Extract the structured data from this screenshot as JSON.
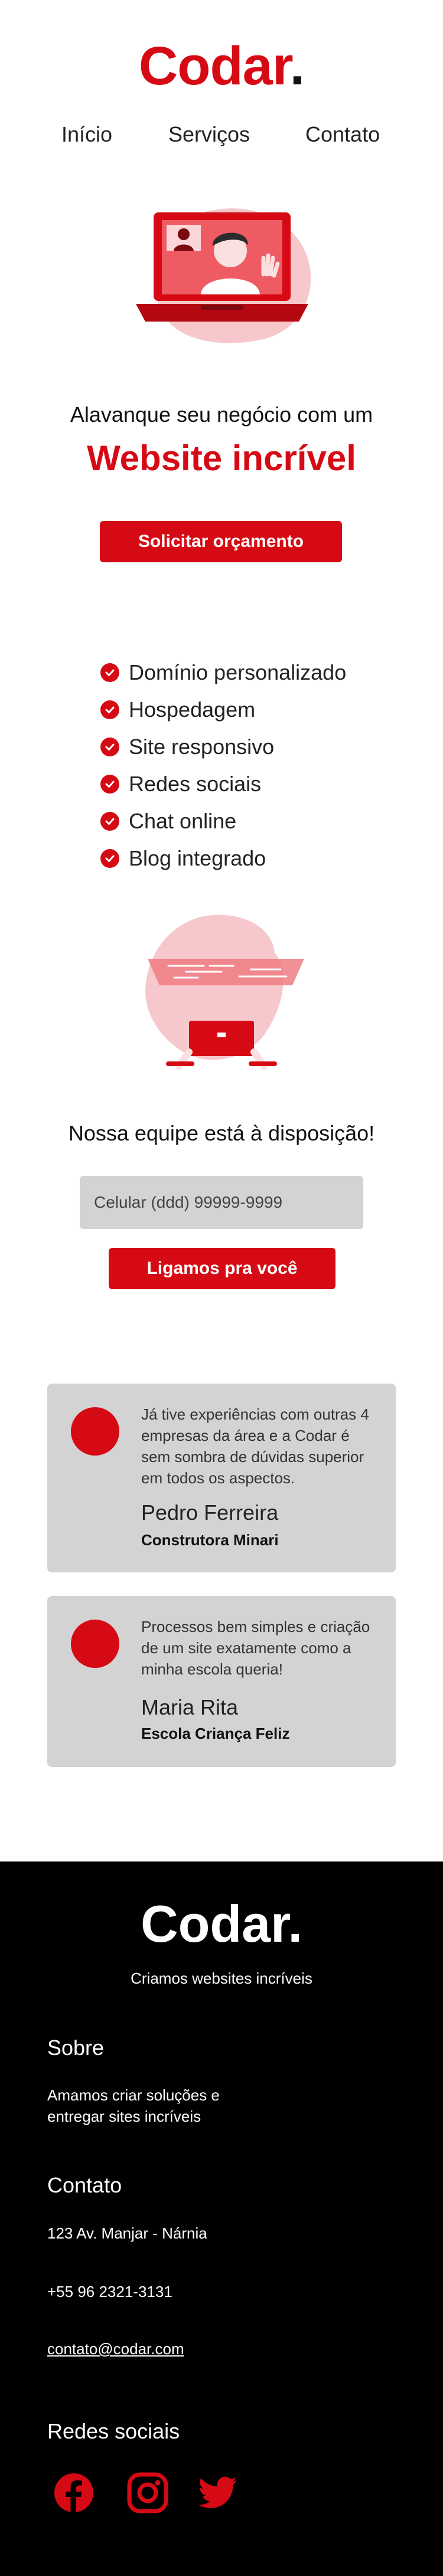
{
  "brand": {
    "name": "Codar",
    "dot": ".",
    "accent": "#d60a14"
  },
  "nav": {
    "items": [
      "Início",
      "Serviços",
      "Contato"
    ]
  },
  "hero": {
    "lead": "Alavanque seu negócio com um",
    "title": "Website incrível",
    "cta": "Solicitar orçamento",
    "illustration": "video-call-laptop-icon"
  },
  "features": {
    "icon": "check-circle-icon",
    "items": [
      "Domínio personalizado",
      "Hospedagem",
      "Site responsivo",
      "Redes sociais",
      "Chat online",
      "Blog integrado"
    ]
  },
  "team": {
    "illustration": "coding-laptop-icon",
    "lead": "Nossa equipe está à disposição!",
    "phone_placeholder": "Celular (ddd) 99999-9999",
    "cta": "Ligamos pra você"
  },
  "testimonials": [
    {
      "quote": "Já tive experiências com outras 4 empresas da área e a Codar é sem sombra de dúvidas superior em todos os aspectos.",
      "author": "Pedro Ferreira",
      "company": "Construtora Minari"
    },
    {
      "quote": "Processos bem simples e criação de um site exatamente como a minha escola queria!",
      "author": "Maria Rita",
      "company": "Escola Criança Feliz"
    }
  ],
  "footer": {
    "logo": "Codar",
    "dot": ".",
    "tagline": "Criamos websites incríveis",
    "about_title": "Sobre",
    "about_text": "Amamos criar soluções e entregar sites incríveis",
    "contact_title": "Contato",
    "address": "123 Av. Manjar - Nárnia",
    "phone": "+55 96 2321-3131",
    "email": "contato@codar.com",
    "social_title": "Redes sociais",
    "social_icons": [
      "facebook-icon",
      "instagram-icon",
      "twitter-icon"
    ]
  }
}
